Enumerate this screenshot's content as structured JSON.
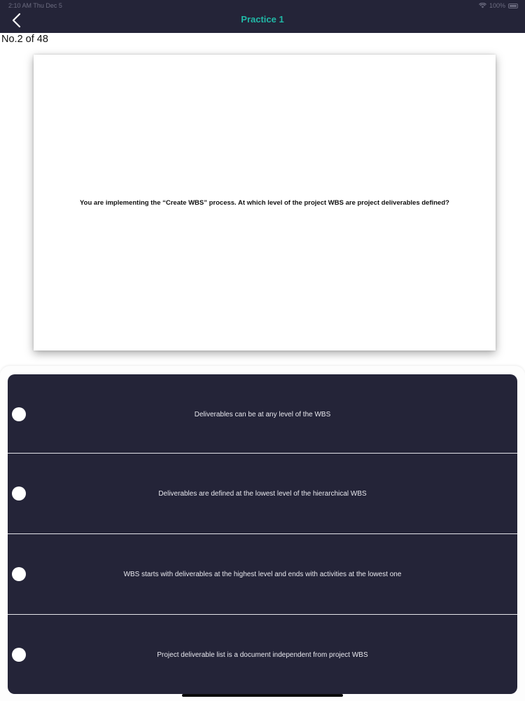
{
  "status_bar": {
    "time": "2:10 AM   Thu Dec 5",
    "battery": "100%"
  },
  "nav": {
    "title": "Practice 1",
    "back_icon": "chevron-left-icon"
  },
  "progress": {
    "label": "No.2 of 48",
    "current": 2,
    "total": 48
  },
  "question": {
    "text": "You are implementing the “Create WBS” process. At which level of the project WBS are project deliverables defined?"
  },
  "options": [
    {
      "label": "Deliverables can be at any level of the WBS"
    },
    {
      "label": "Deliverables are defined at the lowest level of the hierarchical WBS"
    },
    {
      "label": "WBS starts with deliverables at the highest level and ends with activities at the lowest one"
    },
    {
      "label": "Project deliverable list is a document independent from project WBS"
    }
  ],
  "colors": {
    "nav_background": "#242438",
    "title_accent": "#21b8a6",
    "answers_background": "#242438"
  }
}
